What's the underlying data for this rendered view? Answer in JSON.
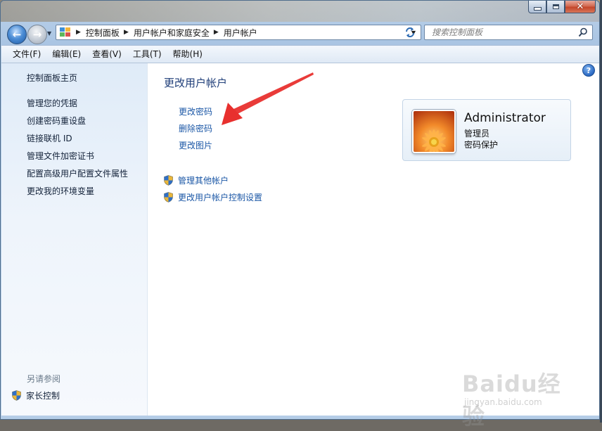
{
  "window": {
    "caption": {
      "minimize": "–",
      "close": "✕"
    }
  },
  "navbar": {
    "breadcrumbs": [
      "控制面板",
      "用户帐户和家庭安全",
      "用户帐户"
    ],
    "search_placeholder": "搜索控制面板"
  },
  "menu": [
    "文件(F)",
    "编辑(E)",
    "查看(V)",
    "工具(T)",
    "帮助(H)"
  ],
  "sidebar": {
    "home": "控制面板主页",
    "items": [
      "管理您的凭据",
      "创建密码重设盘",
      "链接联机 ID",
      "管理文件加密证书",
      "配置高级用户配置文件属性",
      "更改我的环境变量"
    ],
    "see_also_title": "另请参阅",
    "see_also_items": [
      "家长控制"
    ]
  },
  "main": {
    "title": "更改用户帐户",
    "tasks": [
      "更改密码",
      "删除密码",
      "更改图片"
    ],
    "shield_tasks": [
      "管理其他帐户",
      "更改用户帐户控制设置"
    ]
  },
  "user": {
    "name": "Administrator",
    "role": "管理员",
    "status": "密码保护"
  },
  "help": "?",
  "watermark": {
    "main": "Baidu经验",
    "sub": "jingyan.baidu.com"
  },
  "colors": {
    "link": "#1b57a6",
    "title": "#1e3d78",
    "annotation": "#e8302e"
  }
}
